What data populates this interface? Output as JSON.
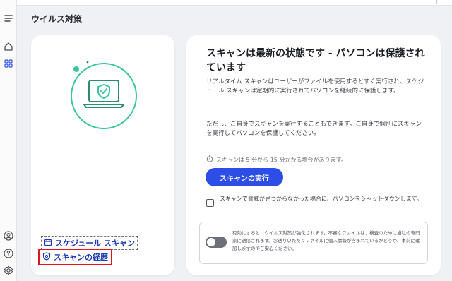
{
  "window": {
    "title": "ウイルス対策"
  },
  "sidebar": {
    "icons": [
      "menu-icon",
      "home-icon",
      "apps-grid-icon",
      "account-icon",
      "help-icon",
      "settings-icon"
    ]
  },
  "left_card": {
    "links": {
      "schedule_scan": "スケジュール スキャン",
      "scan_history": "スキャンの経歴"
    }
  },
  "right_card": {
    "title": "スキャンは最新の状態です - パソコンは保護されています",
    "body1": "リアルタイム スキャンはユーザーがファイルを使用するとすぐ実行され、スケジュール スキャンは定期的に実行されてパソコンを継続的に保護します。",
    "body2": "ただし、ご自身でスキャンを実行することもできます。ご自身で個別にスキャンを実行してパソコンを保護してください。",
    "hint": "スキャンは 5 分から 15 分かかる場合があります。",
    "run_button": "スキャンの実行",
    "shutdown_checkbox": {
      "label": "スキャンで脅威が見つからなかった場合に、パソコンをシャットダウンします。",
      "checked": false
    },
    "notice": {
      "text": "有効にすると、ウイルス対策が強化されます。不審なファイルは、検査のために当社の専門家に送信されます。お送りいただくファイルに個人情報が含まれているかどうか、事前に確認しますのでご安心ください。",
      "toggle_on": false
    }
  },
  "colors": {
    "accent": "#2d4ee6",
    "link": "#1b3bb5",
    "hero_green": "#3cc49a",
    "highlight_red": "#e0141e"
  }
}
